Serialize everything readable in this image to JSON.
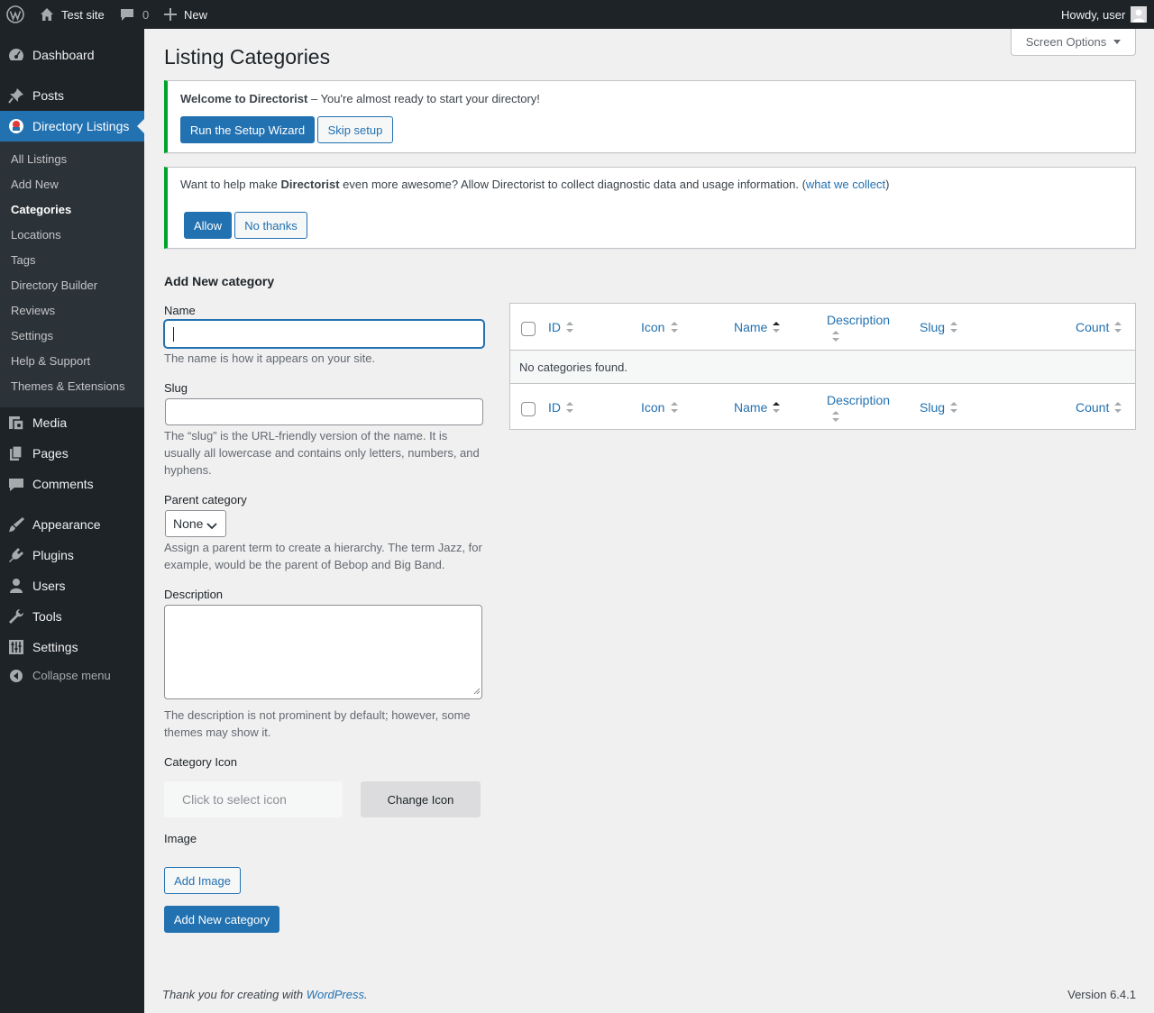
{
  "admin_bar": {
    "site_name": "Test site",
    "comments_count": "0",
    "new_label": "New",
    "howdy": "Howdy, user"
  },
  "sidebar": {
    "items": [
      {
        "label": "Dashboard",
        "icon": "dashboard-icon"
      },
      {
        "label": "Posts",
        "icon": "pin-icon"
      },
      {
        "label": "Directory Listings",
        "icon": "directorist-icon"
      },
      {
        "label": "Media",
        "icon": "media-icon"
      },
      {
        "label": "Pages",
        "icon": "pages-icon"
      },
      {
        "label": "Comments",
        "icon": "comment-icon"
      },
      {
        "label": "Appearance",
        "icon": "brush-icon"
      },
      {
        "label": "Plugins",
        "icon": "plug-icon"
      },
      {
        "label": "Users",
        "icon": "user-icon"
      },
      {
        "label": "Tools",
        "icon": "wrench-icon"
      },
      {
        "label": "Settings",
        "icon": "sliders-icon"
      }
    ],
    "submenu": [
      "All Listings",
      "Add New",
      "Categories",
      "Locations",
      "Tags",
      "Directory Builder",
      "Reviews",
      "Settings",
      "Help & Support",
      "Themes & Extensions"
    ],
    "collapse": "Collapse menu"
  },
  "screen_options": "Screen Options",
  "page_title": "Listing Categories",
  "notice_welcome": {
    "bold": "Welcome to Directorist",
    "text": " – You're almost ready to start your directory!",
    "primary": "Run the Setup Wizard",
    "secondary": "Skip setup"
  },
  "notice_tracking": {
    "pre": "Want to help make ",
    "bold": "Directorist",
    "mid": " even more awesome? Allow Directorist to collect diagnostic data and usage information. (",
    "link": "what we collect",
    "post": ")",
    "allow": "Allow",
    "no_thanks": "No thanks"
  },
  "form": {
    "heading": "Add New category",
    "name_label": "Name",
    "name_value": "",
    "name_desc": "The name is how it appears on your site.",
    "slug_label": "Slug",
    "slug_value": "",
    "slug_desc": "The “slug” is the URL-friendly version of the name. It is usually all lowercase and contains only letters, numbers, and hyphens.",
    "parent_label": "Parent category",
    "parent_value": "None",
    "parent_desc": "Assign a parent term to create a hierarchy. The term Jazz, for example, would be the parent of Bebop and Big Band.",
    "description_label": "Description",
    "description_value": "",
    "description_desc": "The description is not prominent by default; however, some themes may show it.",
    "icon_label": "Category Icon",
    "icon_placeholder": "Click to select icon",
    "change_icon": "Change Icon",
    "image_label": "Image",
    "add_image": "Add Image",
    "submit": "Add New category"
  },
  "table": {
    "columns": [
      "ID",
      "Icon",
      "Name",
      "Description",
      "Slug",
      "Count"
    ],
    "empty": "No categories found."
  },
  "footer": {
    "thanks_pre": "Thank you for creating with ",
    "thanks_link": "WordPress",
    "thanks_post": ".",
    "version": "Version 6.4.1"
  }
}
